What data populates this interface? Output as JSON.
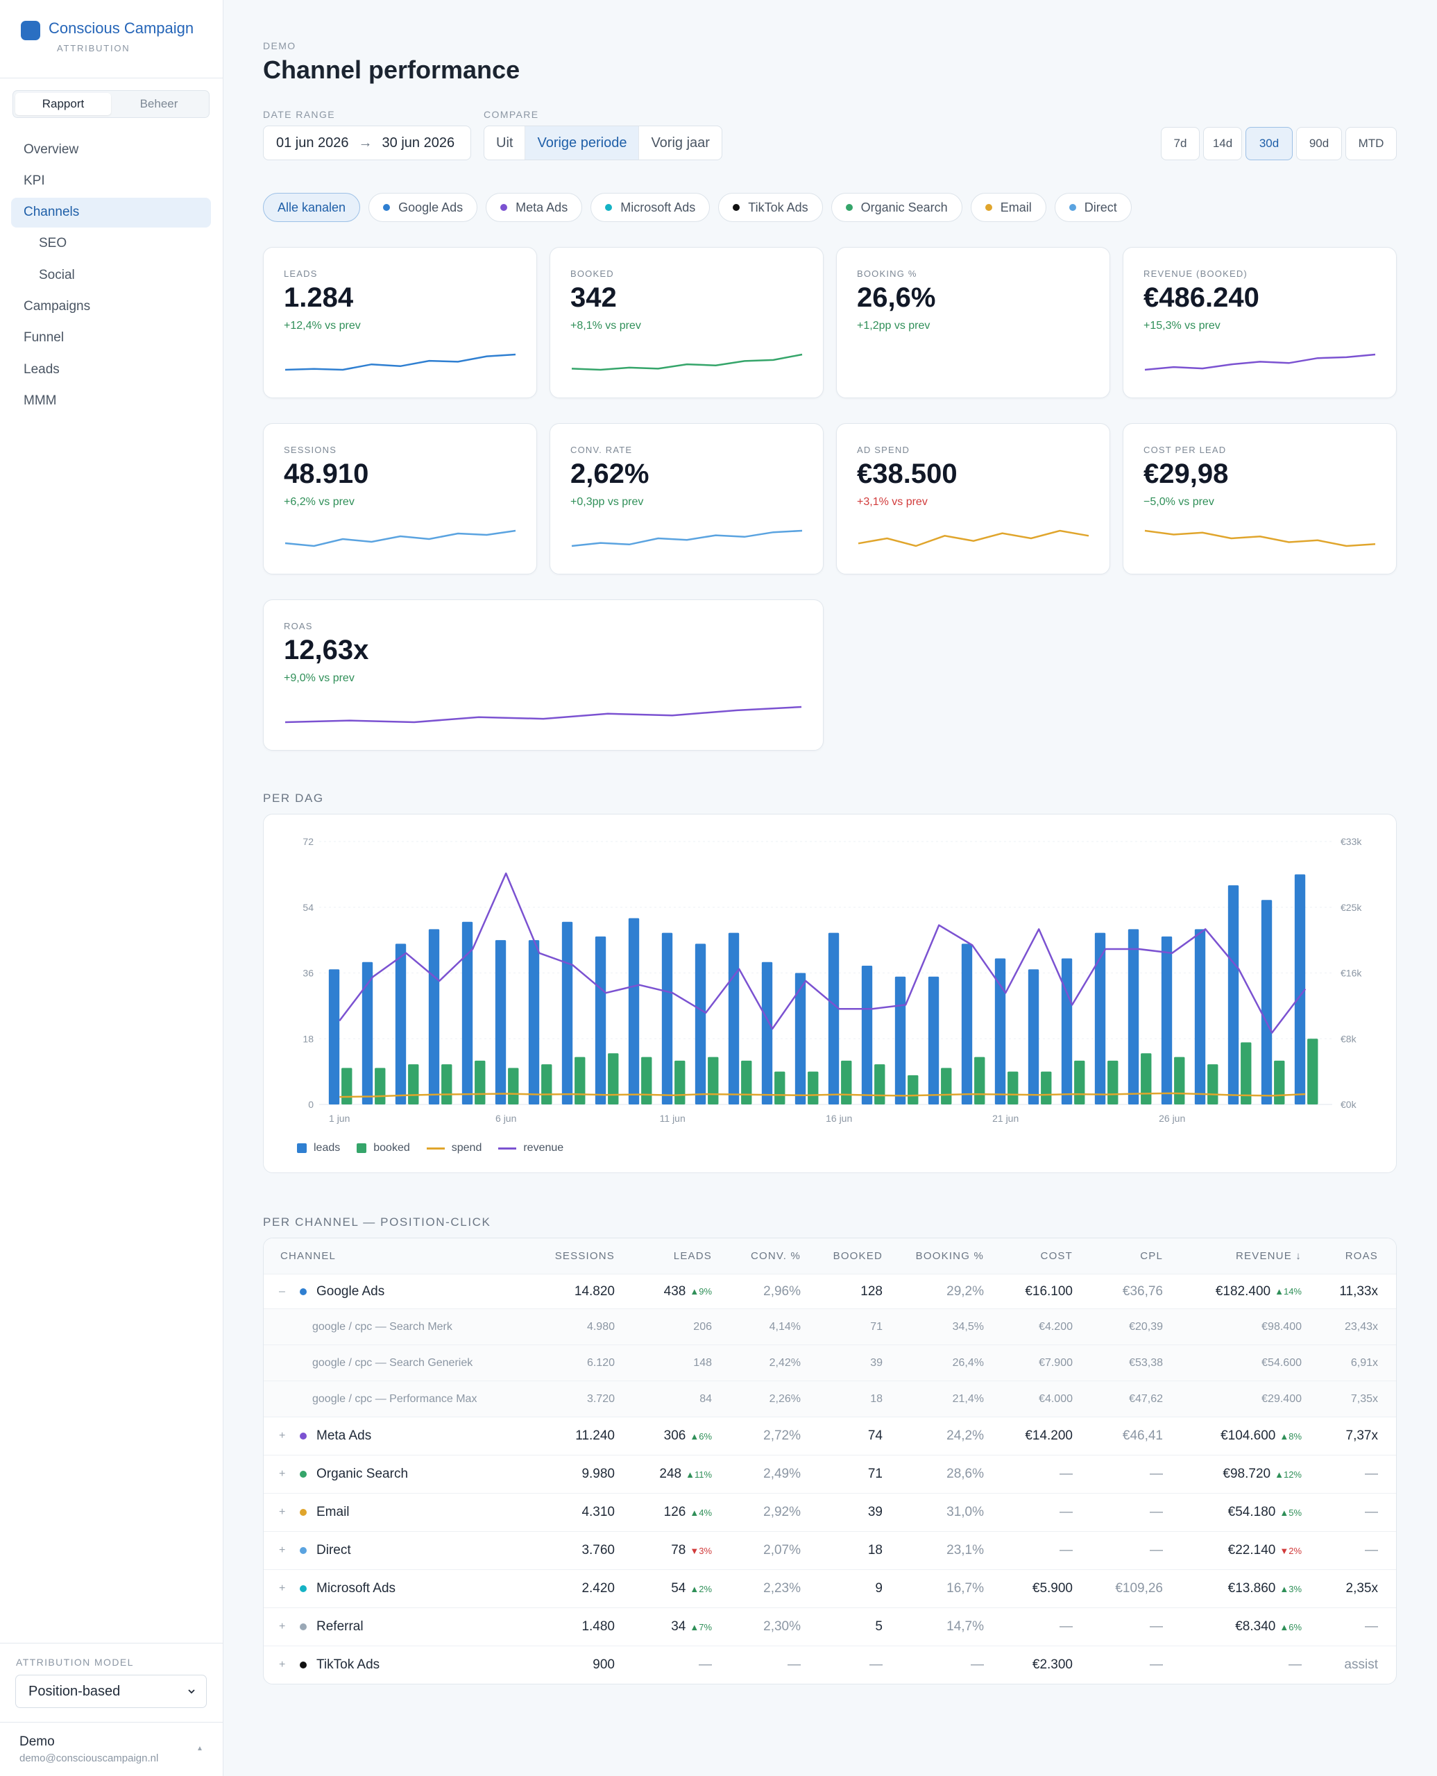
{
  "app": {
    "name": "Conscious Campaign",
    "subtitle": "ATTRIBUTION"
  },
  "sidebar": {
    "segments": [
      {
        "label": "Rapport",
        "active": true
      },
      {
        "label": "Beheer",
        "active": false
      }
    ],
    "nav": [
      {
        "label": "Overview"
      },
      {
        "label": "KPI"
      },
      {
        "label": "Channels",
        "active": true
      },
      {
        "label": "SEO",
        "sub": true
      },
      {
        "label": "Social",
        "sub": true
      },
      {
        "label": "Campaigns"
      },
      {
        "label": "Funnel"
      },
      {
        "label": "Leads"
      },
      {
        "label": "MMM"
      }
    ],
    "attribution_label": "ATTRIBUTION MODEL",
    "attribution_value": "Position-based",
    "user_name": "Demo",
    "user_email": "demo@consciouscampaign.nl"
  },
  "header": {
    "eyebrow": "DEMO",
    "title": "Channel performance",
    "date_range_label": "DATE RANGE",
    "date_from": "01 jun 2026",
    "date_to": "30 jun 2026",
    "compare_label": "COMPARE",
    "compare_options": [
      "Uit",
      "Vorige periode",
      "Vorig jaar"
    ],
    "compare_selected": "Vorige periode",
    "ranges": [
      "7d",
      "14d",
      "30d",
      "90d",
      "MTD"
    ],
    "range_selected": "30d"
  },
  "channel_filters": [
    {
      "label": "Alle kanalen",
      "active": true
    },
    {
      "label": "Google Ads",
      "color": "#2f7fd1"
    },
    {
      "label": "Meta Ads",
      "color": "#7b52d1"
    },
    {
      "label": "Microsoft Ads",
      "color": "#15b2c4"
    },
    {
      "label": "TikTok Ads",
      "color": "#111111"
    },
    {
      "label": "Organic Search",
      "color": "#35a56a"
    },
    {
      "label": "Email",
      "color": "#e0a52c"
    },
    {
      "label": "Direct",
      "color": "#5aa3e0"
    }
  ],
  "kpis": [
    {
      "label": "LEADS",
      "value": "1.284",
      "delta": "+12,4% vs prev",
      "trend": "up",
      "color": "#2f7fd1",
      "spark": [
        14,
        15,
        14,
        20,
        18,
        24,
        23,
        29,
        31
      ]
    },
    {
      "label": "BOOKED",
      "value": "342",
      "delta": "+8,1% vs prev",
      "trend": "up",
      "color": "#35a56a",
      "spark": [
        16,
        15,
        17,
        16,
        20,
        19,
        23,
        24,
        29
      ]
    },
    {
      "label": "BOOKING %",
      "value": "26,6%",
      "delta": "+1,2pp vs prev",
      "trend": "up",
      "color": null,
      "spark": null
    },
    {
      "label": "REVENUE (BOOKED)",
      "value": "€486.240",
      "delta": "+15,3% vs prev",
      "trend": "up",
      "color": "#7b52d1",
      "spark": [
        12,
        18,
        15,
        24,
        30,
        27,
        38,
        40,
        46
      ]
    },
    {
      "label": "SESSIONS",
      "value": "48.910",
      "delta": "+6,2% vs prev",
      "trend": "up",
      "color": "#5aa3e0",
      "spark": [
        20,
        18,
        23,
        21,
        25,
        23,
        27,
        26,
        29
      ]
    },
    {
      "label": "CONV. RATE",
      "value": "2,62%",
      "delta": "+0,3pp vs prev",
      "trend": "up",
      "color": "#5aa3e0",
      "spark": [
        18,
        20,
        19,
        23,
        22,
        25,
        24,
        27,
        28
      ]
    },
    {
      "label": "AD SPEND",
      "value": "€38.500",
      "delta": "+3,1% vs prev",
      "trend": "down",
      "color": "#e0a52c",
      "spark": [
        27,
        29,
        26,
        30,
        28,
        31,
        29,
        32,
        30
      ]
    },
    {
      "label": "COST PER LEAD",
      "value": "€29,98",
      "delta": "−5,0% vs prev",
      "trend": "up",
      "color": "#e0a52c",
      "spark": [
        32,
        30,
        31,
        28,
        29,
        26,
        27,
        24,
        25
      ]
    },
    {
      "label": "ROAS",
      "value": "12,63x",
      "delta": "+9,0% vs prev",
      "trend": "up",
      "color": "#7b52d1",
      "spark": [
        20,
        21,
        20,
        23,
        22,
        25,
        24,
        27,
        29
      ]
    }
  ],
  "per_dag": {
    "title": "PER DAG",
    "chart_data": {
      "type": "bar",
      "x_ticks": [
        "1 jun",
        "6 jun",
        "11 jun",
        "16 jun",
        "21 jun",
        "26 jun"
      ],
      "categories": [
        "1 jun",
        "2 jun",
        "3 jun",
        "4 jun",
        "5 jun",
        "6 jun",
        "7 jun",
        "8 jun",
        "9 jun",
        "10 jun",
        "11 jun",
        "12 jun",
        "13 jun",
        "14 jun",
        "15 jun",
        "16 jun",
        "17 jun",
        "18 jun",
        "19 jun",
        "20 jun",
        "21 jun",
        "22 jun",
        "23 jun",
        "24 jun",
        "25 jun",
        "26 jun",
        "27 jun",
        "28 jun",
        "29 jun",
        "30 jun"
      ],
      "left_axis": {
        "ticks": [
          "0",
          "18",
          "36",
          "54",
          "72"
        ],
        "ylim": [
          0,
          72
        ]
      },
      "right_axis": {
        "ticks": [
          "€0k",
          "€8k",
          "€16k",
          "€25k",
          "€33k"
        ],
        "ylim": [
          0,
          33000
        ]
      },
      "series": [
        {
          "name": "leads",
          "kind": "bar",
          "axis": "left",
          "color": "#2f7fd1",
          "values": [
            37,
            39,
            44,
            48,
            50,
            45,
            45,
            50,
            46,
            51,
            47,
            44,
            47,
            39,
            36,
            47,
            38,
            35,
            35,
            44,
            40,
            37,
            40,
            47,
            48,
            46,
            48,
            60,
            56,
            63
          ]
        },
        {
          "name": "booked",
          "kind": "bar",
          "axis": "left",
          "color": "#35a56a",
          "values": [
            10,
            10,
            11,
            11,
            12,
            10,
            11,
            13,
            14,
            13,
            12,
            13,
            12,
            9,
            9,
            12,
            11,
            8,
            10,
            13,
            9,
            9,
            12,
            12,
            14,
            13,
            11,
            17,
            12,
            18
          ]
        },
        {
          "name": "spend",
          "kind": "line",
          "axis": "right",
          "color": "#e0a52c",
          "values": [
            950,
            1000,
            1150,
            1250,
            1300,
            1350,
            1250,
            1300,
            1200,
            1250,
            1150,
            1300,
            1250,
            1200,
            1150,
            1250,
            1150,
            1100,
            1200,
            1300,
            1250,
            1200,
            1300,
            1250,
            1350,
            1400,
            1300,
            1150,
            1100,
            1300
          ]
        },
        {
          "name": "revenue",
          "kind": "line",
          "axis": "right",
          "color": "#7b52d1",
          "values": [
            10500,
            16000,
            19000,
            15500,
            19500,
            29000,
            19000,
            17500,
            14000,
            15000,
            14000,
            11500,
            17000,
            9500,
            15500,
            12000,
            12000,
            12500,
            22500,
            20000,
            14000,
            22000,
            12500,
            19500,
            19500,
            19000,
            22000,
            17000,
            9000,
            14500
          ]
        }
      ],
      "legend": [
        "leads",
        "booked",
        "spend",
        "revenue"
      ],
      "legend_placement": "bottom-left",
      "grid": true
    }
  },
  "per_channel": {
    "title": "PER CHANNEL — POSITION-CLICK",
    "columns": [
      "CHANNEL",
      "SESSIONS",
      "LEADS",
      "CONV. %",
      "BOOKED",
      "BOOKING %",
      "COST",
      "CPL",
      "REVENUE ↓",
      "ROAS"
    ],
    "rows": [
      {
        "toggle": "–",
        "color": "#2f7fd1",
        "channel": "Google Ads",
        "sessions": "14.820",
        "leads": "438",
        "leads_delta": "▲9%",
        "leads_dir": "up",
        "conv": "2,96%",
        "booked": "128",
        "booking": "29,2%",
        "cost": "€16.100",
        "cpl": "€36,76",
        "revenue": "€182.400",
        "rev_delta": "▲14%",
        "rev_dir": "up",
        "roas": "11,33x",
        "subs": [
          {
            "channel": "google / cpc — Search Merk",
            "sessions": "4.980",
            "leads": "206",
            "conv": "4,14%",
            "booked": "71",
            "booking": "34,5%",
            "cost": "€4.200",
            "cpl": "€20,39",
            "revenue": "€98.400",
            "roas": "23,43x"
          },
          {
            "channel": "google / cpc — Search Generiek",
            "sessions": "6.120",
            "leads": "148",
            "conv": "2,42%",
            "booked": "39",
            "booking": "26,4%",
            "cost": "€7.900",
            "cpl": "€53,38",
            "revenue": "€54.600",
            "roas": "6,91x"
          },
          {
            "channel": "google / cpc — Performance Max",
            "sessions": "3.720",
            "leads": "84",
            "conv": "2,26%",
            "booked": "18",
            "booking": "21,4%",
            "cost": "€4.000",
            "cpl": "€47,62",
            "revenue": "€29.400",
            "roas": "7,35x"
          }
        ]
      },
      {
        "toggle": "+",
        "color": "#7b52d1",
        "channel": "Meta Ads",
        "sessions": "11.240",
        "leads": "306",
        "leads_delta": "▲6%",
        "leads_dir": "up",
        "conv": "2,72%",
        "booked": "74",
        "booking": "24,2%",
        "cost": "€14.200",
        "cpl": "€46,41",
        "revenue": "€104.600",
        "rev_delta": "▲8%",
        "rev_dir": "up",
        "roas": "7,37x"
      },
      {
        "toggle": "+",
        "color": "#35a56a",
        "channel": "Organic Search",
        "sessions": "9.980",
        "leads": "248",
        "leads_delta": "▲11%",
        "leads_dir": "up",
        "conv": "2,49%",
        "booked": "71",
        "booking": "28,6%",
        "cost": "—",
        "cpl": "—",
        "revenue": "€98.720",
        "rev_delta": "▲12%",
        "rev_dir": "up",
        "roas": "—"
      },
      {
        "toggle": "+",
        "color": "#e0a52c",
        "channel": "Email",
        "sessions": "4.310",
        "leads": "126",
        "leads_delta": "▲4%",
        "leads_dir": "up",
        "conv": "2,92%",
        "booked": "39",
        "booking": "31,0%",
        "cost": "—",
        "cpl": "—",
        "revenue": "€54.180",
        "rev_delta": "▲5%",
        "rev_dir": "up",
        "roas": "—"
      },
      {
        "toggle": "+",
        "color": "#5aa3e0",
        "channel": "Direct",
        "sessions": "3.760",
        "leads": "78",
        "leads_delta": "▼3%",
        "leads_dir": "down",
        "conv": "2,07%",
        "booked": "18",
        "booking": "23,1%",
        "cost": "—",
        "cpl": "—",
        "revenue": "€22.140",
        "rev_delta": "▼2%",
        "rev_dir": "down",
        "roas": "—"
      },
      {
        "toggle": "+",
        "color": "#15b2c4",
        "channel": "Microsoft Ads",
        "sessions": "2.420",
        "leads": "54",
        "leads_delta": "▲2%",
        "leads_dir": "up",
        "conv": "2,23%",
        "booked": "9",
        "booking": "16,7%",
        "cost": "€5.900",
        "cpl": "€109,26",
        "revenue": "€13.860",
        "rev_delta": "▲3%",
        "rev_dir": "up",
        "roas": "2,35x"
      },
      {
        "toggle": "+",
        "color": "#9aa8b6",
        "channel": "Referral",
        "sessions": "1.480",
        "leads": "34",
        "leads_delta": "▲7%",
        "leads_dir": "up",
        "conv": "2,30%",
        "booked": "5",
        "booking": "14,7%",
        "cost": "—",
        "cpl": "—",
        "revenue": "€8.340",
        "rev_delta": "▲6%",
        "rev_dir": "up",
        "roas": "—"
      },
      {
        "toggle": "+",
        "color": "#111111",
        "channel": "TikTok Ads",
        "sessions": "900",
        "leads": "—",
        "leads_delta": "",
        "leads_dir": "up",
        "conv": "—",
        "booked": "—",
        "booking": "—",
        "cost": "€2.300",
        "cpl": "—",
        "revenue": "—",
        "rev_delta": "",
        "rev_dir": "up",
        "roas": "assist"
      }
    ]
  }
}
